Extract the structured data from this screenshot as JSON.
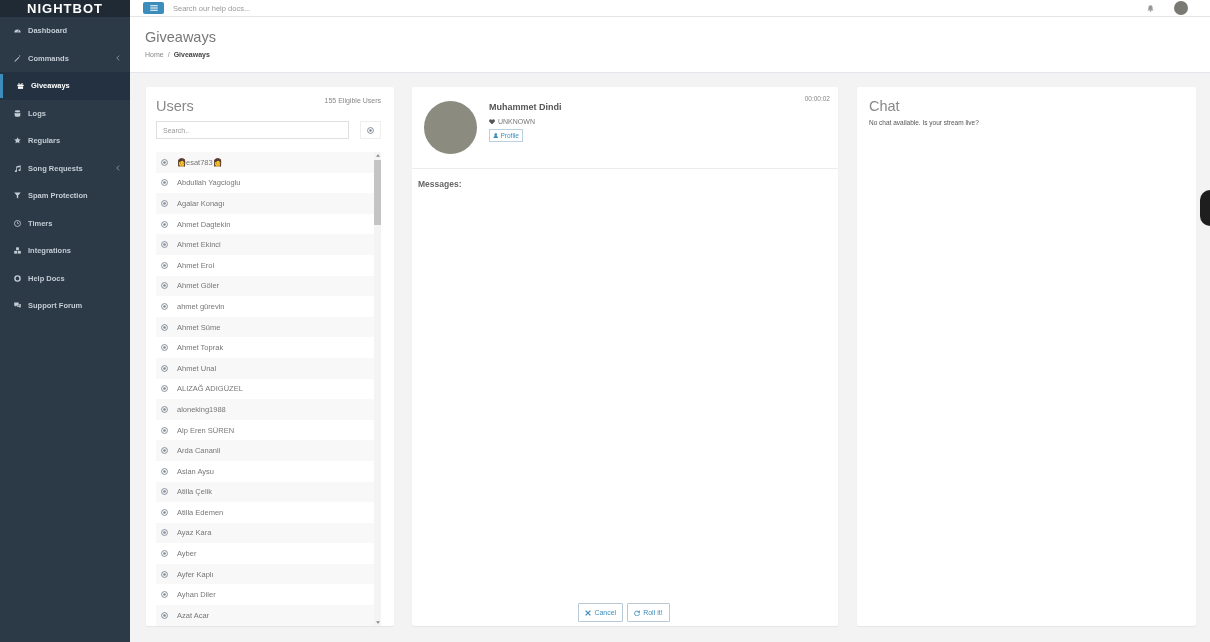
{
  "topbar": {
    "logo": "NIGHTBOT",
    "search": {
      "placeholder": "Search our help docs..."
    }
  },
  "sidebar": {
    "items": [
      {
        "label": "Dashboard",
        "selected": false,
        "has_submenu": false
      },
      {
        "label": "Commands",
        "selected": false,
        "has_submenu": true
      },
      {
        "label": "Giveaways",
        "selected": true,
        "has_submenu": false
      },
      {
        "label": "Logs",
        "selected": false,
        "has_submenu": false
      },
      {
        "label": "Regulars",
        "selected": false,
        "has_submenu": false
      },
      {
        "label": "Song Requests",
        "selected": false,
        "has_submenu": true
      },
      {
        "label": "Spam Protection",
        "selected": false,
        "has_submenu": false
      },
      {
        "label": "Timers",
        "selected": false,
        "has_submenu": false
      },
      {
        "label": "Integrations",
        "selected": false,
        "has_submenu": false
      },
      {
        "label": "Help Docs",
        "selected": false,
        "has_submenu": false
      },
      {
        "label": "Support Forum",
        "selected": false,
        "has_submenu": false
      }
    ]
  },
  "page_header": {
    "title": "Giveaways",
    "breadcrumb": {
      "separator": "/",
      "items": [
        {
          "label": "Home",
          "current": false
        },
        {
          "label": "Giveaways",
          "current": true
        }
      ]
    }
  },
  "users_panel": {
    "title": "Users",
    "count": "155 Eligible Users",
    "search": {
      "placeholder": "Search.."
    },
    "users": [
      "👩esat783👩",
      "Abdullah Yagcioglu",
      "Agalar Konagı",
      "Ahmet Dagtekin",
      "Ahmet Ekinci",
      "Ahmet Erol",
      "Ahmet Göler",
      "ahmet gürevin",
      "Ahmet Süme",
      "Ahmet Toprak",
      "Ahmet Unal",
      "ALIZAĞ ADIGÜZEL",
      "aloneking1988",
      "Alp Eren SÜREN",
      "Arda Cananli",
      "Aslan Aysu",
      "Atilla Çelik",
      "Atilla Edemen",
      "Ayaz Kara",
      "Ayber",
      "Ayfer Kaplı",
      "Ayhan Diler",
      "Azat Acar"
    ]
  },
  "winner_panel": {
    "name": "Muhammet Dindi",
    "status": "UNKNOWN",
    "profile_button": "Profile",
    "timer": "00:00:02",
    "messages_label": "Messages:",
    "buttons": [
      {
        "label": "Cancel",
        "kind": "cancel"
      },
      {
        "label": "Roll it!",
        "kind": "roll"
      }
    ]
  },
  "chat_panel": {
    "title": "Chat",
    "message": "No chat available. Is your stream live?"
  }
}
